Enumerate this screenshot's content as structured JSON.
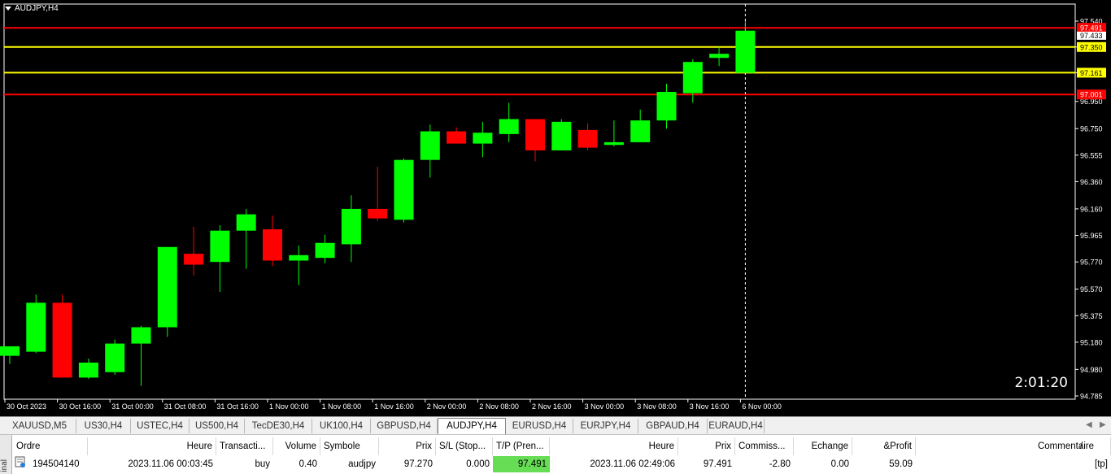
{
  "chart": {
    "title": "AUDJPY,H4",
    "countdown": "2:01:20",
    "colors": {
      "background": "#000000",
      "bull": "#00ff00",
      "bear": "#ff0000",
      "grid_text": "#ffffff",
      "red_line": "#ff0000",
      "yellow_line": "#ffff00"
    },
    "price_labels": [
      "97.540",
      "97.350",
      "97.161",
      "96.950",
      "96.750",
      "96.555",
      "96.360",
      "96.160",
      "95.965",
      "95.770",
      "95.570",
      "95.375",
      "95.180",
      "94.980",
      "94.785"
    ],
    "time_labels": [
      "30 Oct 2023",
      "30 Oct 16:00",
      "31 Oct 00:00",
      "31 Oct 08:00",
      "31 Oct 16:00",
      "1 Nov 00:00",
      "1 Nov 08:00",
      "1 Nov 16:00",
      "2 Nov 00:00",
      "2 Nov 08:00",
      "2 Nov 16:00",
      "3 Nov 00:00",
      "3 Nov 08:00",
      "3 Nov 16:00",
      "6 Nov 00:00"
    ],
    "hlines": [
      {
        "price": 97.491,
        "label": "97.491",
        "color": "red"
      },
      {
        "price": 97.35,
        "label": "97.350",
        "color": "yellow"
      },
      {
        "price": 97.161,
        "label": "97.161",
        "color": "yellow"
      },
      {
        "price": 97.001,
        "label": "97.001",
        "color": "red"
      }
    ],
    "bid_label": "97.433"
  },
  "chart_data": {
    "type": "candlestick",
    "title": "AUDJPY,H4",
    "ylim": [
      94.785,
      97.54
    ],
    "candles": [
      {
        "o": 95.08,
        "h": 95.14,
        "l": 95.02,
        "c": 95.15
      },
      {
        "o": 95.11,
        "h": 95.53,
        "l": 95.1,
        "c": 95.47
      },
      {
        "o": 95.47,
        "h": 95.53,
        "l": 94.92,
        "c": 94.92
      },
      {
        "o": 94.92,
        "h": 95.06,
        "l": 94.91,
        "c": 95.03
      },
      {
        "o": 94.96,
        "h": 95.2,
        "l": 94.94,
        "c": 95.17
      },
      {
        "o": 95.17,
        "h": 95.3,
        "l": 94.86,
        "c": 95.29
      },
      {
        "o": 95.29,
        "h": 95.88,
        "l": 95.22,
        "c": 95.88
      },
      {
        "o": 95.83,
        "h": 96.03,
        "l": 95.67,
        "c": 95.75
      },
      {
        "o": 95.77,
        "h": 96.04,
        "l": 95.55,
        "c": 96.0
      },
      {
        "o": 96.0,
        "h": 96.16,
        "l": 95.72,
        "c": 96.12
      },
      {
        "o": 96.01,
        "h": 96.11,
        "l": 95.74,
        "c": 95.78
      },
      {
        "o": 95.78,
        "h": 95.89,
        "l": 95.6,
        "c": 95.82
      },
      {
        "o": 95.8,
        "h": 95.97,
        "l": 95.76,
        "c": 95.91
      },
      {
        "o": 95.9,
        "h": 96.26,
        "l": 95.77,
        "c": 96.16
      },
      {
        "o": 96.16,
        "h": 96.47,
        "l": 96.07,
        "c": 96.09
      },
      {
        "o": 96.08,
        "h": 96.53,
        "l": 96.06,
        "c": 96.52
      },
      {
        "o": 96.52,
        "h": 96.78,
        "l": 96.39,
        "c": 96.73
      },
      {
        "o": 96.73,
        "h": 96.76,
        "l": 96.64,
        "c": 96.64
      },
      {
        "o": 96.64,
        "h": 96.8,
        "l": 96.54,
        "c": 96.72
      },
      {
        "o": 96.71,
        "h": 96.94,
        "l": 96.65,
        "c": 96.82
      },
      {
        "o": 96.82,
        "h": 96.82,
        "l": 96.51,
        "c": 96.59
      },
      {
        "o": 96.59,
        "h": 96.82,
        "l": 96.59,
        "c": 96.8
      },
      {
        "o": 96.74,
        "h": 96.79,
        "l": 96.59,
        "c": 96.61
      },
      {
        "o": 96.63,
        "h": 96.81,
        "l": 96.62,
        "c": 96.65
      },
      {
        "o": 96.65,
        "h": 96.89,
        "l": 96.65,
        "c": 96.81
      },
      {
        "o": 96.81,
        "h": 97.08,
        "l": 96.75,
        "c": 97.02
      },
      {
        "o": 97.01,
        "h": 97.26,
        "l": 96.94,
        "c": 97.24
      },
      {
        "o": 97.27,
        "h": 97.35,
        "l": 97.21,
        "c": 97.3
      },
      {
        "o": 97.16,
        "h": 97.54,
        "l": 97.16,
        "c": 97.47
      }
    ]
  },
  "tabs": {
    "items": [
      "XAUUSD,M5",
      "US30,H4",
      "USTEC,H4",
      "US500,H4",
      "TecDE30,H4",
      "UK100,H4",
      "GBPUSD,H4",
      "AUDJPY,H4",
      "EURUSD,H4",
      "EURJPY,H4",
      "GBPAUD,H4",
      "EURAUD,H4"
    ],
    "active": "AUDJPY,H4"
  },
  "terminal": {
    "side_label": "inal",
    "headers": [
      "Ordre",
      "Heure",
      "Transacti...",
      "Volume",
      "Symbole",
      "Prix",
      "S/L (Stop...",
      "T/P (Pren...",
      "Heure",
      "Prix",
      "Commiss...",
      "Echange",
      "&Profit",
      "Commentaire"
    ],
    "row": [
      "194504140",
      "2023.11.06 00:03:45",
      "buy",
      "0.40",
      "audjpy",
      "97.270",
      "0.000",
      "97.491",
      "2023.11.06 02:49:06",
      "97.491",
      "-2.80",
      "0.00",
      "59.09",
      "[tp]"
    ],
    "sort_glyph": "/"
  }
}
